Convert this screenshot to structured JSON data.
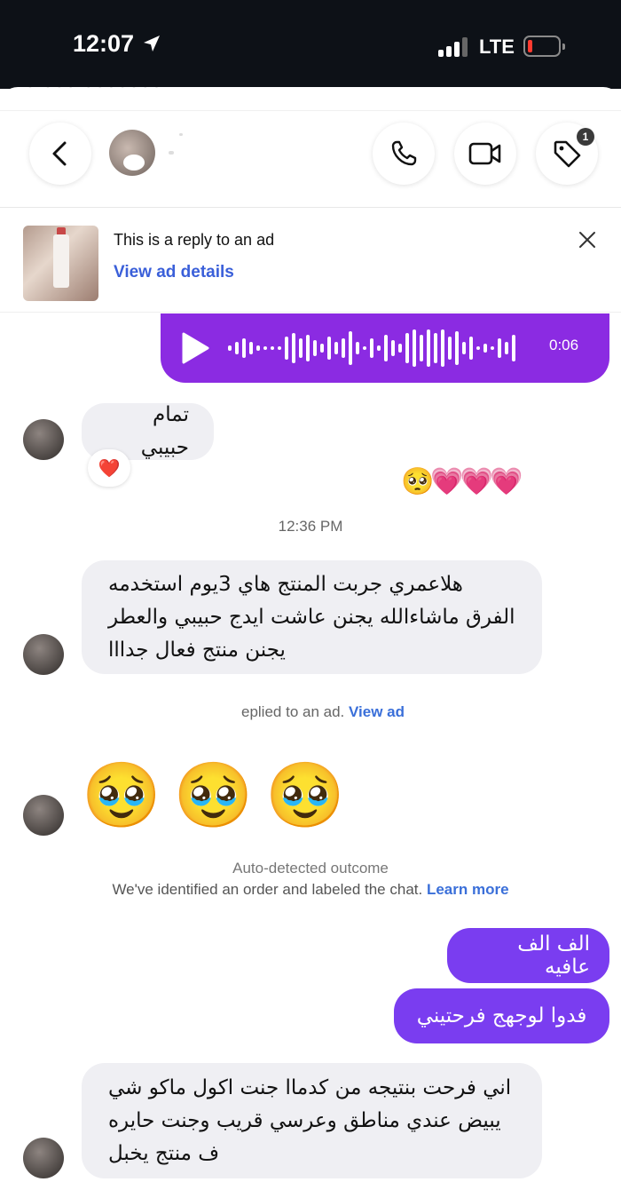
{
  "status_bar": {
    "time": "12:07",
    "network": "LTE",
    "signal_bars": 3,
    "battery_level": 0.1
  },
  "header": {
    "previous_strip_text": "• ••• •••••••",
    "notification_badge": "1"
  },
  "ad_banner": {
    "title": "This is a reply to an ad",
    "link": "View ad details"
  },
  "voice_message": {
    "duration": "0:06"
  },
  "messages": {
    "m1": "تمام حبيبي",
    "m1_reaction": "❤️",
    "m1_emojis": "🥺💗💗💗",
    "timestamp": "12:36 PM",
    "m2_line1": "هلاعمري جربت المنتج هاي 3يوم استخدمه",
    "m2_line2": "الفرق ماشاءالله يجنن عاشت ايدج حبيبي والعطر",
    "m2_line3": "يجنن منتج فعال جدااا",
    "ad_notice_text": "eplied to an ad.",
    "ad_notice_link": "View ad",
    "m3_emojis": "🥹🥹🥹",
    "outcome_title": "Auto-detected outcome",
    "outcome_text": "We've identified an order and labeled the chat.",
    "outcome_link": "Learn more",
    "out1": "الف الف عافيه",
    "out2": "فدوا لوجهج فرحتيني",
    "m4_line1": "اني فرحت بنتيجه من كدماا جنت اكول ماكو شي",
    "m4_line2": "يبيض عندي مناطق وعرسي قريب وجنت حايره",
    "m4_line3": "ف منتج يخبل"
  },
  "colors": {
    "outgoing": "#7a3df0",
    "voice": "#8b2be2",
    "incoming": "#efeff3",
    "link": "#3a6fd9"
  }
}
